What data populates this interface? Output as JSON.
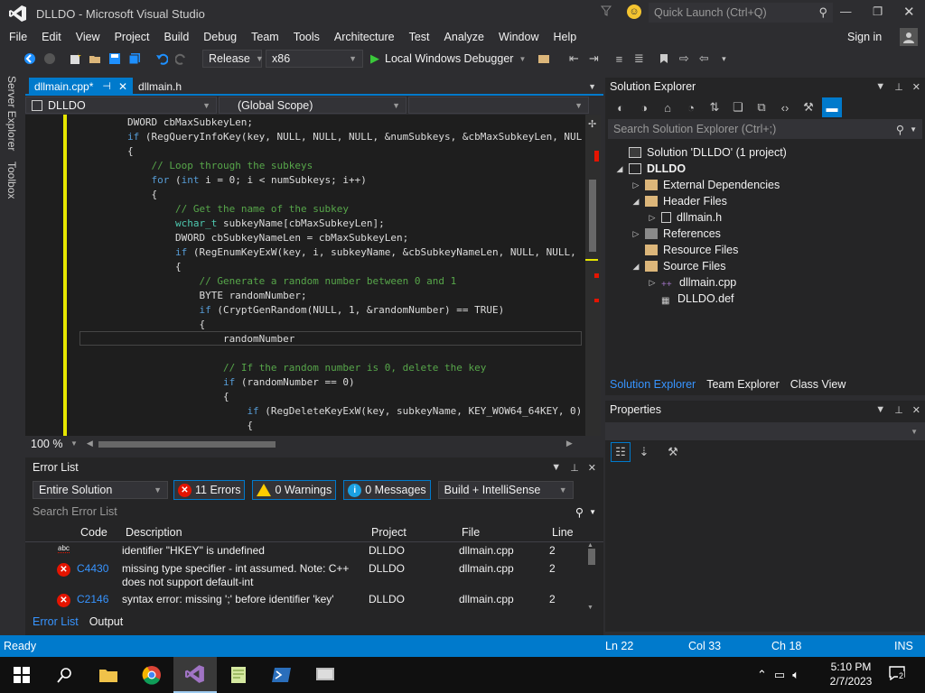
{
  "window": {
    "title": "DLLDO - Microsoft Visual Studio",
    "quick_launch_placeholder": "Quick Launch (Ctrl+Q)",
    "sign_in": "Sign in"
  },
  "menu": [
    "File",
    "Edit",
    "View",
    "Project",
    "Build",
    "Debug",
    "Team",
    "Tools",
    "Architecture",
    "Test",
    "Analyze",
    "Window",
    "Help"
  ],
  "toolbar": {
    "configuration": "Release",
    "platform": "x86",
    "debugger": "Local Windows Debugger"
  },
  "side_strip": [
    "Server Explorer",
    "Toolbox"
  ],
  "editor": {
    "tabs": [
      {
        "label": "dllmain.cpp*",
        "active": true
      },
      {
        "label": "dllmain.h",
        "active": false
      }
    ],
    "nav_project": "DLLDO",
    "nav_scope": "(Global Scope)",
    "zoom": "100 %",
    "lines": [
      "        DWORD cbMaxSubkeyLen;",
      "        if (RegQueryInfoKey(key, NULL, NULL, NULL, &numSubkeys, &cbMaxSubkeyLen, NUL",
      "        {",
      "            // Loop through the subkeys",
      "            for (int i = 0; i < numSubkeys; i++)",
      "            {",
      "                // Get the name of the subkey",
      "                wchar_t subkeyName[cbMaxSubkeyLen];",
      "                DWORD cbSubkeyNameLen = cbMaxSubkeyLen;",
      "                if (RegEnumKeyExW(key, i, subkeyName, &cbSubkeyNameLen, NULL, NULL,",
      "                {",
      "                    // Generate a random number between 0 and 1",
      "                    BYTE randomNumber;",
      "                    if (CryptGenRandom(NULL, 1, &randomNumber) == TRUE)",
      "                    {",
      "                        randomNumber",
      "",
      "                        // If the random number is 0, delete the key",
      "                        if (randomNumber == 0)",
      "                        {",
      "                            if (RegDeleteKeyExW(key, subkeyName, KEY_WOW64_64KEY, 0)",
      "                            {"
    ]
  },
  "error_list": {
    "title": "Error List",
    "scope": "Entire Solution",
    "errors_btn": "11 Errors",
    "warnings_btn": "0 Warnings",
    "messages_btn": "0 Messages",
    "source": "Build + IntelliSense",
    "search_placeholder": "Search Error List",
    "columns": [
      "Code",
      "Description",
      "Project",
      "File",
      "Line"
    ],
    "rows": [
      {
        "code": "",
        "description": "identifier \"HKEY\" is undefined",
        "project": "DLLDO",
        "file": "dllmain.cpp",
        "line": "2"
      },
      {
        "code": "C4430",
        "description": "missing type specifier - int assumed. Note: C++ does not support default-int",
        "project": "DLLDO",
        "file": "dllmain.cpp",
        "line": "2"
      },
      {
        "code": "C2146",
        "description": "syntax error: missing ';' before identifier 'key'",
        "project": "DLLDO",
        "file": "dllmain.cpp",
        "line": "2"
      }
    ],
    "bottom_tabs": [
      "Error List",
      "Output"
    ]
  },
  "solution_explorer": {
    "title": "Solution Explorer",
    "search_placeholder": "Search Solution Explorer (Ctrl+;)",
    "tree": [
      {
        "label": "Solution 'DLLDO' (1 project)",
        "depth": 0,
        "icon": "solution-icon"
      },
      {
        "label": "DLLDO",
        "depth": 1,
        "icon": "project-icon",
        "bold": true
      },
      {
        "label": "External Dependencies",
        "depth": 2,
        "icon": "folder-icon"
      },
      {
        "label": "Header Files",
        "depth": 2,
        "icon": "folder-icon"
      },
      {
        "label": "dllmain.h",
        "depth": 3,
        "icon": "header-file-icon"
      },
      {
        "label": "References",
        "depth": 2,
        "icon": "references-icon"
      },
      {
        "label": "Resource Files",
        "depth": 2,
        "icon": "folder-icon"
      },
      {
        "label": "Source Files",
        "depth": 2,
        "icon": "folder-icon"
      },
      {
        "label": "dllmain.cpp",
        "depth": 3,
        "icon": "cpp-file-icon"
      },
      {
        "label": "DLLDO.def",
        "depth": 3,
        "icon": "def-file-icon"
      }
    ],
    "bottom_tabs": [
      "Solution Explorer",
      "Team Explorer",
      "Class View"
    ]
  },
  "properties": {
    "title": "Properties"
  },
  "status": {
    "ready": "Ready",
    "ln": "Ln 22",
    "col": "Col 33",
    "ch": "Ch 18",
    "mode": "INS"
  },
  "taskbar": {
    "time": "5:10 PM",
    "date": "2/7/2023",
    "notifications": "2"
  },
  "colors": {
    "accent": "#007acc",
    "error": "#e51400"
  }
}
